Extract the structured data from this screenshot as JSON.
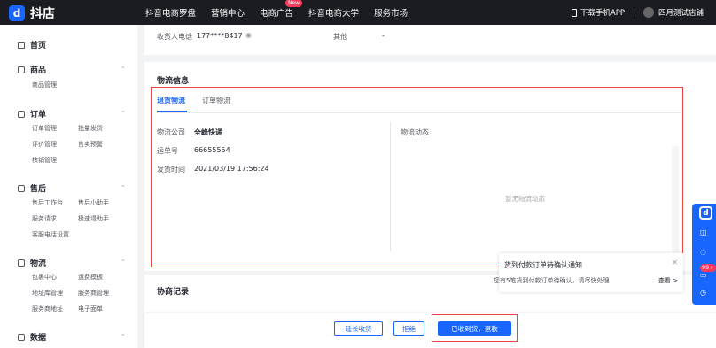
{
  "topbar": {
    "logo_mark": "d",
    "logo_text": "抖店",
    "nav": [
      "抖音电商罗盘",
      "营销中心",
      "电商广告",
      "抖音电商大学",
      "服务市场"
    ],
    "nav_badge": "New",
    "download_app": "下载手机APP",
    "shop_name": "四月测试店铺"
  },
  "sidebar": {
    "home": "首页",
    "goods": {
      "title": "商品",
      "links": [
        "商品管理"
      ]
    },
    "orders": {
      "title": "订单",
      "links": [
        "订单管理",
        "批量发货",
        "评价管理",
        "售卖预警",
        "核销管理"
      ]
    },
    "aftersale": {
      "title": "售后",
      "links": [
        "售后工作台",
        "售后小助手",
        "服务请求",
        "极速退助手",
        "客服电话设置"
      ]
    },
    "logistics": {
      "title": "物流",
      "links": [
        "包裹中心",
        "运费模板",
        "地址库管理",
        "服务商管理",
        "服务商地址",
        "电子面单"
      ]
    },
    "data": {
      "title": "数据"
    }
  },
  "receiver": {
    "phone_label": "收货人电话",
    "phone_value": "177****8417",
    "other_label": "其他",
    "other_value": "-"
  },
  "logistics": {
    "title": "物流信息",
    "tabs": [
      "退货物流",
      "订单物流"
    ],
    "company_label": "物流公司",
    "company_value": "全峰快递",
    "tracking_label": "运单号",
    "tracking_value": "66655554",
    "ship_time_label": "发货时间",
    "ship_time_value": "2021/03/19 17:56:24",
    "dynamics_label": "物流动态",
    "empty_text": "暂无物流动态"
  },
  "notice": {
    "title": "货到付款订单待确认通知",
    "text": "您有5笔货到付款订单待确认，请尽快处理",
    "link": "查看 >"
  },
  "negotiation": {
    "title": "协商记录"
  },
  "actions": {
    "extend": "延长收货",
    "reject": "拒绝",
    "received": "已收到货，退款"
  },
  "float": {
    "badge": "99+"
  }
}
